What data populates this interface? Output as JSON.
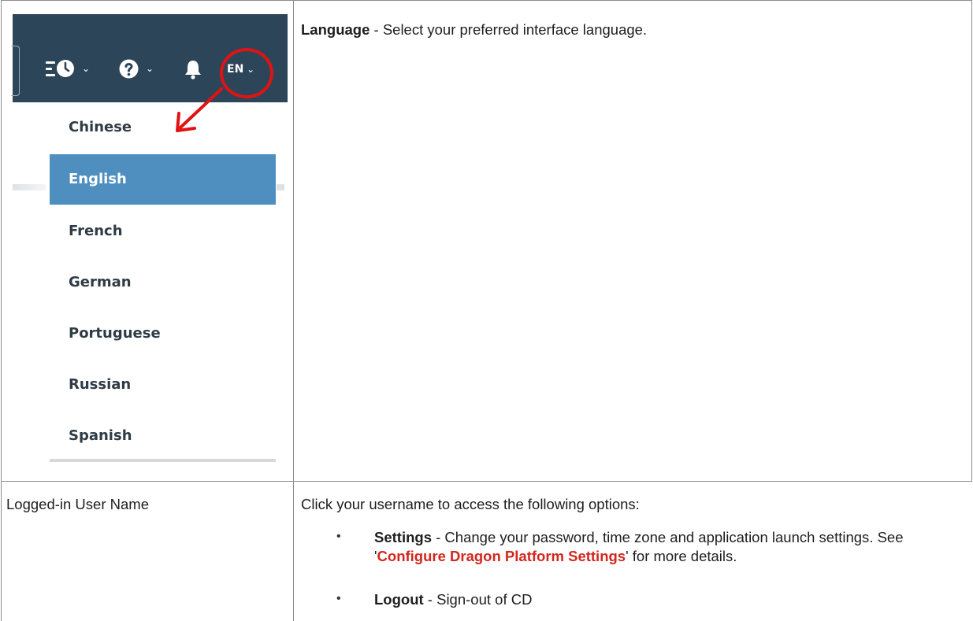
{
  "screenshot": {
    "toolbar": {
      "icons": [
        "menu-lines-icon",
        "clock-icon",
        "help-icon",
        "bell-icon"
      ],
      "language_button": "EN"
    },
    "language_menu": {
      "items": [
        "Chinese",
        "English",
        "French",
        "German",
        "Portuguese",
        "Russian",
        "Spanish"
      ],
      "selected": "English"
    },
    "colors": {
      "topbar": "#2d4558",
      "selected_item": "#4f8fc0",
      "annotation": "#e01313"
    }
  },
  "rows": [
    {
      "description_term": "Language",
      "description_text": " - Select your preferred interface language."
    },
    {
      "name": "Logged-in User Name",
      "intro": "Click your username to access the following options:",
      "options": [
        {
          "term": "Settings",
          "text_before": " - Change your password, time zone and application launch settings. See '",
          "link": "Configure Dragon Platform Settings",
          "text_after": "' for more details."
        },
        {
          "term": "Logout",
          "text": " - Sign-out of CD"
        }
      ]
    }
  ]
}
